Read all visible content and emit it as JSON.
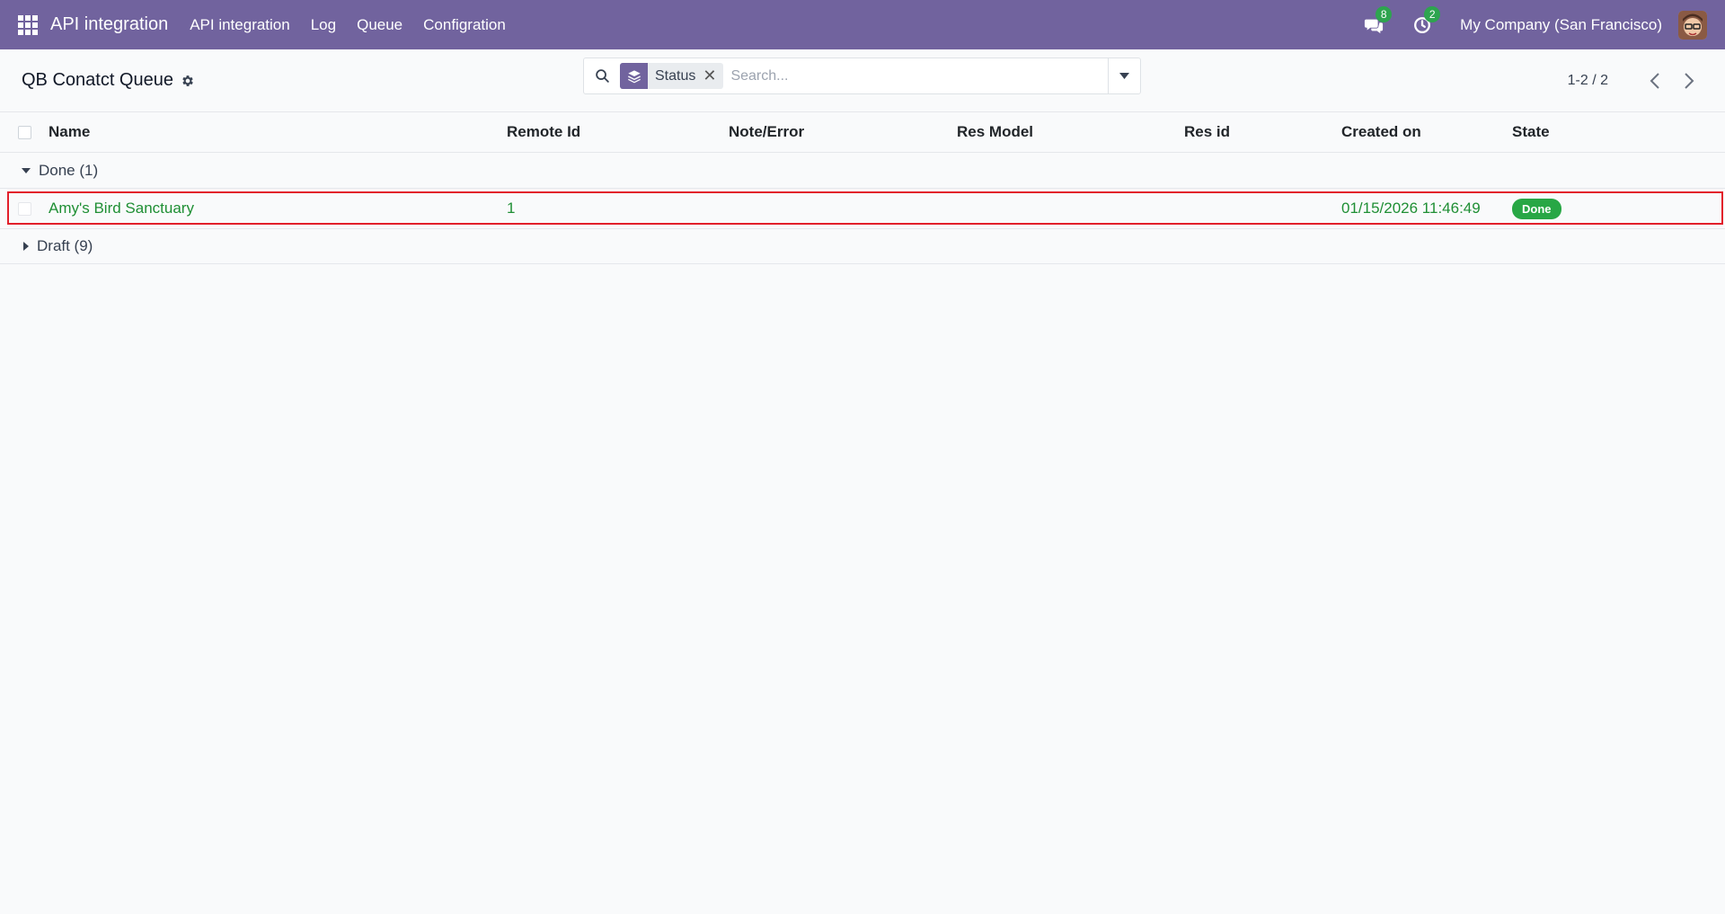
{
  "navbar": {
    "brand": "API integration",
    "menu": [
      "API integration",
      "Log",
      "Queue",
      "Configration"
    ],
    "messages_count": "8",
    "activities_count": "2",
    "company": "My Company (San Francisco)"
  },
  "control": {
    "title": "QB Conatct Queue",
    "facet_label": "Status",
    "search_placeholder": "Search...",
    "pager": "1-2 / 2"
  },
  "table": {
    "columns": [
      "Name",
      "Remote Id",
      "Note/Error",
      "Res Model",
      "Res id",
      "Created on",
      "State"
    ],
    "groups": [
      {
        "label": "Done (1)",
        "expanded": true,
        "rows": [
          {
            "name": "Amy's Bird Sanctuary",
            "remote_id": "1",
            "note": "",
            "res_model": "",
            "res_id": "",
            "created_on": "01/15/2026 11:46:49",
            "state": "Done"
          }
        ]
      },
      {
        "label": "Draft (9)",
        "expanded": false,
        "rows": []
      }
    ]
  },
  "colors": {
    "navbar": "#71639e",
    "success": "#28a745",
    "highlight": "#e21f2b"
  }
}
